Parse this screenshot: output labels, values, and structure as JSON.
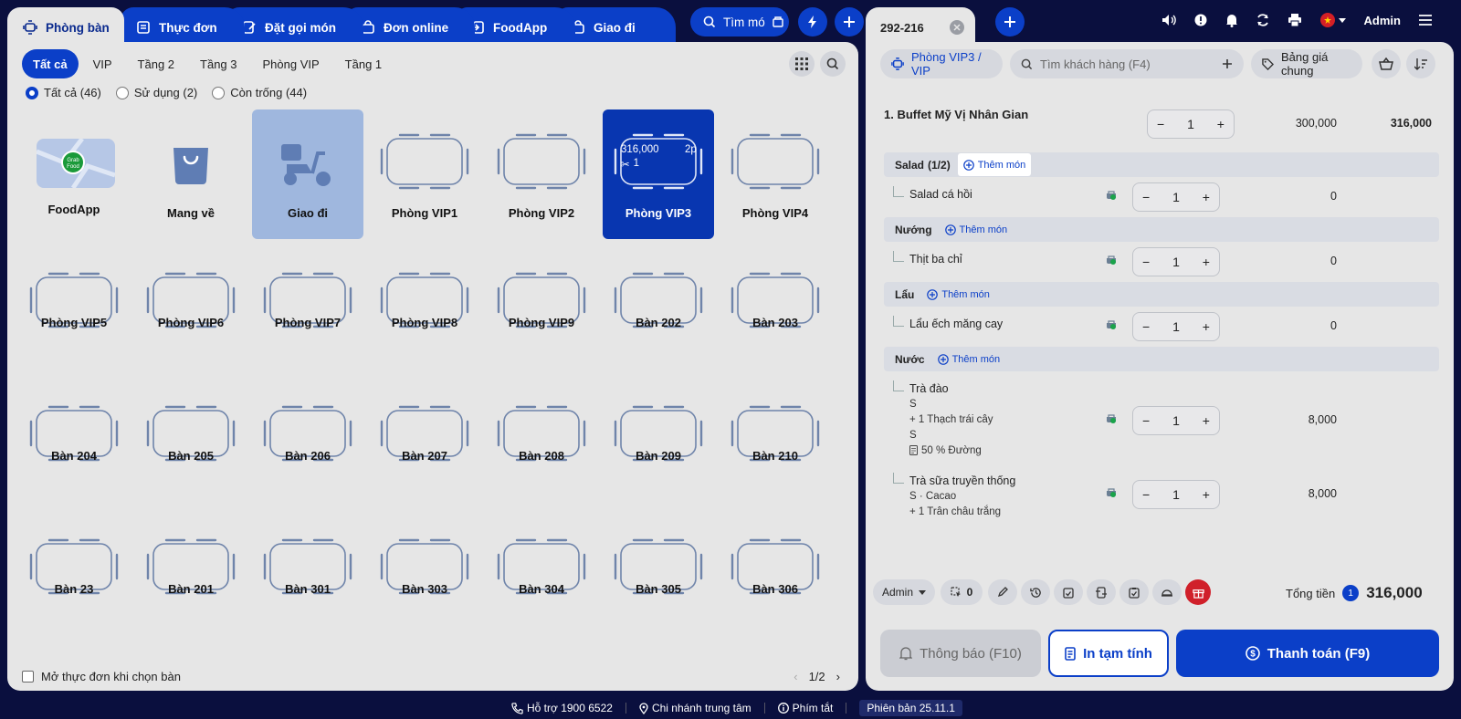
{
  "top_tabs": [
    "Phòng bàn",
    "Thực đơn",
    "Đặt gọi món",
    "Đơn online",
    "FoodApp",
    "Giao đi"
  ],
  "search_label": "Tìm mó",
  "order_tab": "292-216",
  "admin": "Admin",
  "filters": [
    "Tất cả",
    "VIP",
    "Tầng 2",
    "Tầng 3",
    "Phòng VIP",
    "Tầng 1"
  ],
  "radios": [
    "Tất cả (46)",
    "Sử dụng (2)",
    "Còn trống (44)"
  ],
  "tiles_row1": [
    "FoodApp",
    "Mang về",
    "Giao đi",
    "Phòng VIP1",
    "Phòng VIP2",
    "Phòng VIP3",
    "Phòng VIP4"
  ],
  "tiles_row2": [
    "Phòng VIP5",
    "Phòng VIP6",
    "Phòng VIP7",
    "Phòng VIP8",
    "Phòng VIP9",
    "Bàn 202",
    "Bàn 203"
  ],
  "tiles_row3": [
    "Bàn 204",
    "Bàn 205",
    "Bàn 206",
    "Bàn 207",
    "Bàn 208",
    "Bàn 209",
    "Bàn 210"
  ],
  "tiles_row4": [
    "Bàn 23",
    "Bàn 201",
    "Bàn 301",
    "Bàn 303",
    "Bàn 304",
    "Bàn 305",
    "Bàn 306"
  ],
  "grab_text": "Grab Food",
  "vip3": {
    "amount": "316,000",
    "time": "2p",
    "guests": "1"
  },
  "open_menu_label": "Mở thực đơn khi chọn bàn",
  "pager": "1/2",
  "room_pill": "Phòng VIP3 / VIP",
  "customer_placeholder": "Tìm khách hàng (F4)",
  "price_list": "Bảng giá chung",
  "combo": {
    "name": "1. Buffet Mỹ Vị Nhân Gian",
    "qty": "1",
    "unit": "300,000",
    "total": "316,000"
  },
  "groups": [
    {
      "name": "Salad",
      "count": "(1/2)",
      "add": "Thêm món"
    },
    {
      "name": "Nướng",
      "count": "",
      "add": "Thêm món"
    },
    {
      "name": "Lẩu",
      "count": "",
      "add": "Thêm món"
    },
    {
      "name": "Nước",
      "count": "",
      "add": "Thêm món"
    }
  ],
  "items": [
    {
      "name": "Salad cá hồi",
      "qty": "1",
      "price": "0"
    },
    {
      "name": "Thịt ba chỉ",
      "qty": "1",
      "price": "0"
    },
    {
      "name": "Lẩu ếch măng cay",
      "qty": "1",
      "price": "0"
    },
    {
      "name": "Trà đào",
      "qty": "1",
      "price": "8,000",
      "lines": [
        "S",
        "+ 1 Thạch trái cây",
        "S",
        "50 % Đường"
      ]
    },
    {
      "name": "Trà sữa truyền thống",
      "qty": "1",
      "price": "8,000",
      "lines": [
        "S · Cacao",
        "+ 1 Trân châu trắng"
      ]
    }
  ],
  "bottom": {
    "admin": "Admin",
    "count": "0",
    "total_label": "Tổng tiền",
    "total_badge": "1",
    "total": "316,000"
  },
  "actions": {
    "notify": "Thông báo (F10)",
    "print": "In tạm tính",
    "pay": "Thanh toán (F9)"
  },
  "status": [
    "Hỗ trợ 1900 6522",
    "Chi nhánh trung tâm",
    "Phím tắt",
    "Phiên bản 25.11.1"
  ],
  "colors": {
    "primary": "#0b3fc8",
    "selected": "#0836b0",
    "bg": "#0a0f3e",
    "gift": "#d0202a"
  }
}
